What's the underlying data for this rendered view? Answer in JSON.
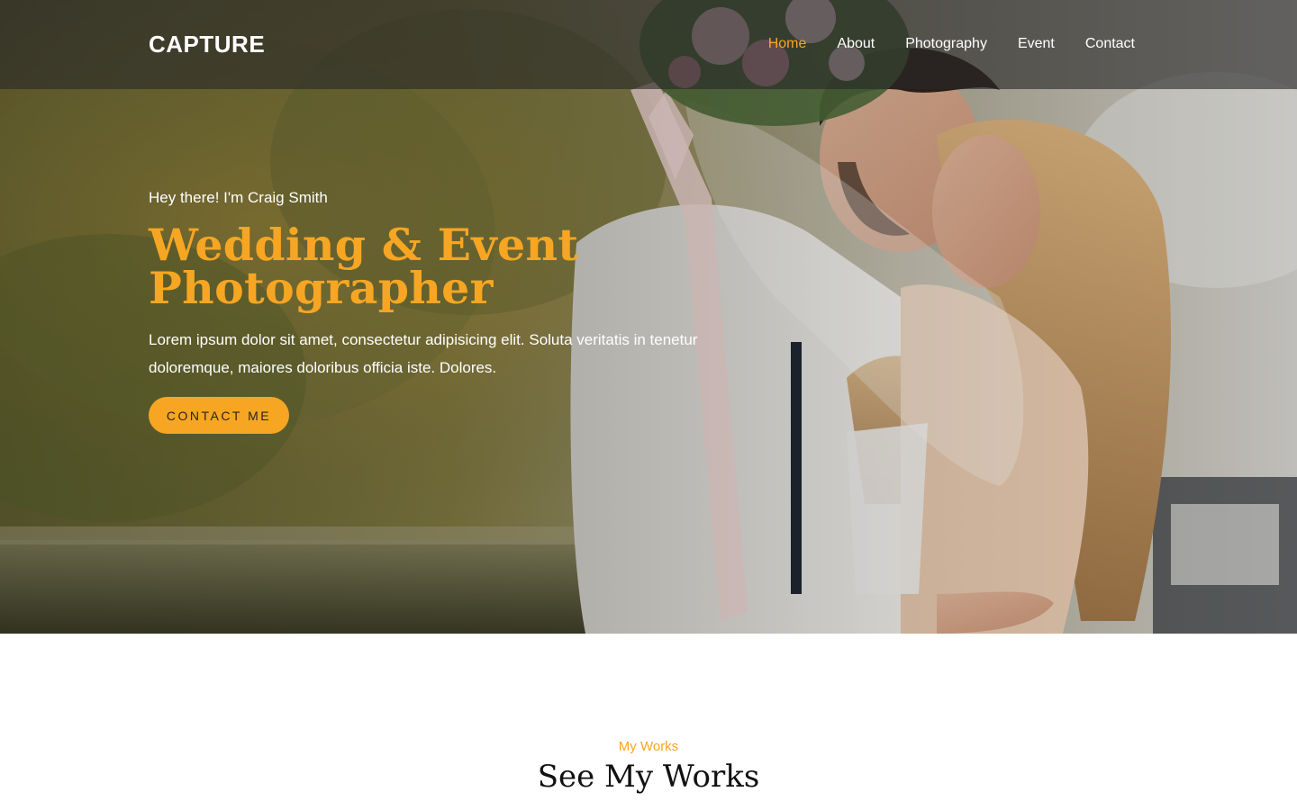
{
  "colors": {
    "accent": "#f6a623",
    "navbar_bg": "rgba(40,40,40,0.62)",
    "text_light": "#ffffff",
    "text_dark": "#111111"
  },
  "navbar": {
    "brand": "CAPTURE",
    "links": [
      {
        "label": "Home",
        "active": true
      },
      {
        "label": "About",
        "active": false
      },
      {
        "label": "Photography",
        "active": false
      },
      {
        "label": "Event",
        "active": false
      },
      {
        "label": "Contact",
        "active": false
      }
    ]
  },
  "hero": {
    "greeting": "Hey there! I'm Craig Smith",
    "title_line1": "Wedding & Event",
    "title_line2": "Photographer",
    "description": "Lorem ipsum dolor sit amet, consectetur adipisicing elit. Soluta veritatis in tenetur doloremque, maiores doloribus officia iste. Dolores.",
    "cta_label": "CONTACT ME"
  },
  "works": {
    "kicker": "My Works",
    "title": "See My Works"
  }
}
